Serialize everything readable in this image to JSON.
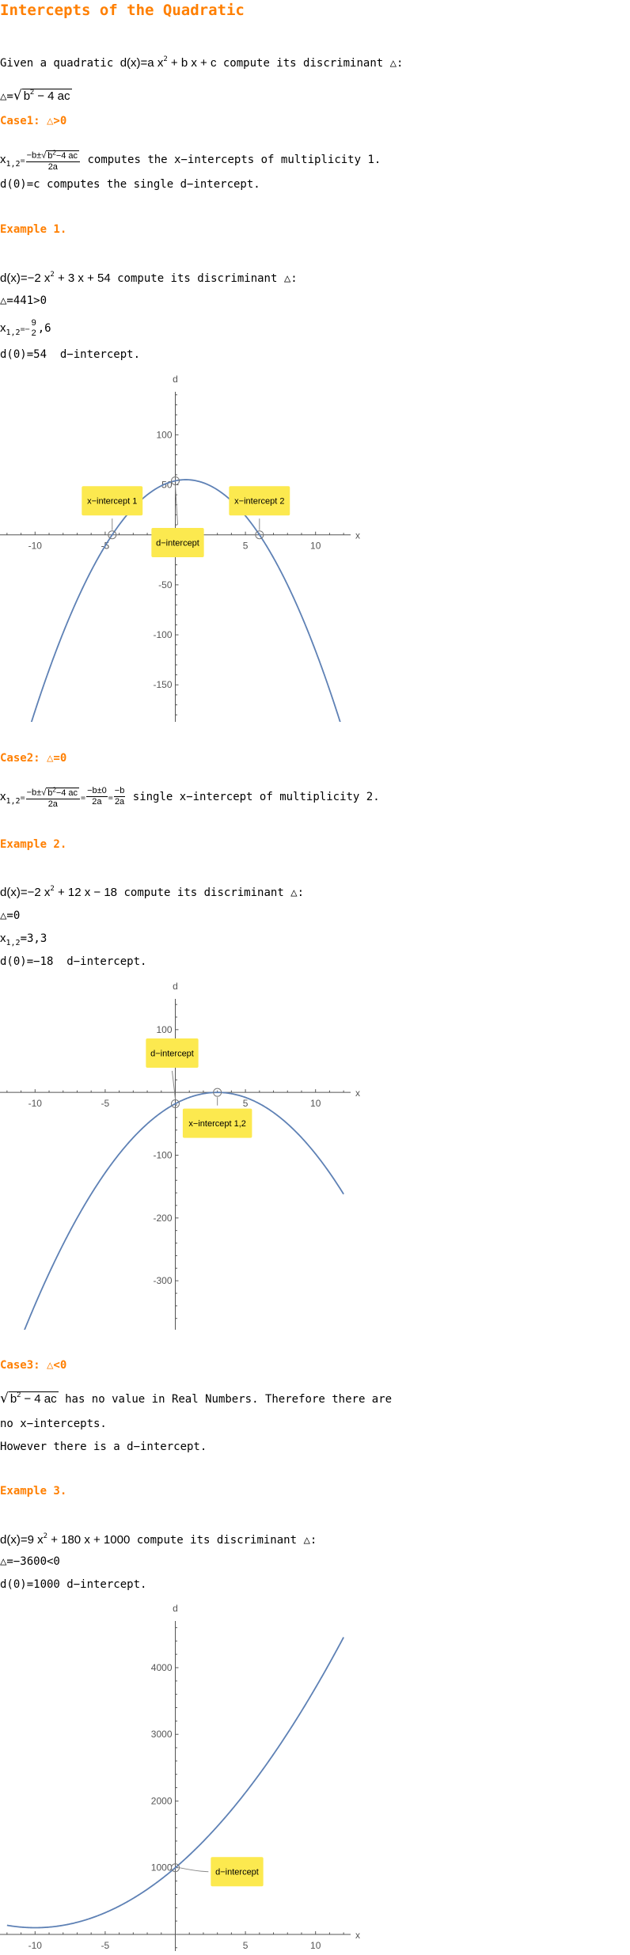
{
  "title": "Intercepts of the Quadratic",
  "intro": {
    "prefix": "Given a quadratic ",
    "lhs": "d(x)=a x",
    "exp": "2",
    "rhs": " + b x + c",
    "suffix": " compute its discriminant △:"
  },
  "discriminant_def": {
    "lhs": "△=",
    "sqrt": "√",
    "base": "b",
    "exp": "2",
    "rest": " − 4 ac"
  },
  "case1": {
    "heading": "Case1: △>0",
    "x_lhs": "x",
    "x_sub": "1,2",
    "eq": "=",
    "num_pre": "−b±",
    "sqrt": "√",
    "rad_base": "b",
    "rad_exp": "2",
    "rad_rest": "−4 ac",
    "den": "2a",
    "text": " computes the x−intercepts of multiplicity 1.",
    "d_line": "d(0)=c computes the single d−intercept."
  },
  "example1": {
    "heading": "Example 1.",
    "fn_lhs": "d(x)=−2 x",
    "fn_exp": "2",
    "fn_rhs": " + 3 x + 54",
    "fn_suffix": " compute its discriminant △:",
    "disc": "△=441>0",
    "roots_lhs": "x",
    "roots_sub": "1,2",
    "roots_eq": "=−",
    "roots_num": "9",
    "roots_den": "2",
    "roots_rest": ",6",
    "d0": "d(0)=54  d−intercept."
  },
  "case2": {
    "heading": "Case2: △=0",
    "x_lhs": "x",
    "x_sub": "1,2",
    "eq": "=",
    "num_pre": "−b±",
    "sqrt": "√",
    "rad_base": "b",
    "rad_exp": "2",
    "rad_rest": "−4 ac",
    "den": "2a",
    "eq2": "=",
    "num2": "−b±0",
    "den2": "2a",
    "eq3": "=",
    "num3": "−b",
    "den3": "2a",
    "text": " single x−intercept of multiplicity 2."
  },
  "example2": {
    "heading": "Example 2.",
    "fn_lhs": "d(x)=−2 x",
    "fn_exp": "2",
    "fn_rhs": " + 12 x − 18",
    "fn_suffix": " compute its discriminant △:",
    "disc": "△=0",
    "roots_lhs": "x",
    "roots_sub": "1,2",
    "roots_rest": "=3,3",
    "d0": "d(0)=−18  d−intercept."
  },
  "case3": {
    "heading": "Case3: △<0",
    "sqrt": "√",
    "base": "b",
    "exp": "2",
    "rest": " − 4 ac",
    "text": " has no value in Real Numbers. Therefore there are",
    "text2": "no x−intercepts.",
    "text3": "However there is a d−intercept."
  },
  "example3": {
    "heading": "Example 3.",
    "fn_lhs": "d(x)=9 x",
    "fn_exp": "2",
    "fn_rhs": " + 180 x + 1000",
    "fn_suffix": " compute its discriminant △:",
    "disc": "△=−3600<0",
    "d0": "d(0)=1000 d−intercept."
  },
  "colors": {
    "heading": "#ff7f00",
    "curve": "#5e81b5",
    "label_bg": "#fce94f",
    "axis": "#555555"
  },
  "chart_data": [
    {
      "type": "line",
      "function": "-2 x^2 + 3 x + 54",
      "coefficients": [
        -2,
        3,
        54
      ],
      "xlabel": "x",
      "ylabel": "d",
      "xlim": [
        -12.5,
        12.5
      ],
      "ylim": [
        -187,
        143
      ],
      "x_ticks": [
        "-10",
        "-5",
        "5",
        "10"
      ],
      "y_ticks": [
        "-150",
        "-100",
        "-50",
        "50",
        "100"
      ],
      "annotations": [
        {
          "label": "x−intercept 1",
          "x": -4.5,
          "y": 0
        },
        {
          "label": "x−intercept 2",
          "x": 6,
          "y": 0
        },
        {
          "label": "d−intercept",
          "x": 0,
          "y": 54
        }
      ]
    },
    {
      "type": "line",
      "function": "-2 x^2 + 12 x - 18",
      "coefficients": [
        -2,
        12,
        -18
      ],
      "xlabel": "x",
      "ylabel": "d",
      "xlim": [
        -12.5,
        12.5
      ],
      "ylim": [
        -378,
        149
      ],
      "x_ticks": [
        "-10",
        "-5",
        "5",
        "10"
      ],
      "y_ticks": [
        "-300",
        "-200",
        "-100",
        "100"
      ],
      "annotations": [
        {
          "label": "d−intercept",
          "x": 0,
          "y": -18
        },
        {
          "label": "x−intercept 1,2",
          "x": 3,
          "y": 0
        }
      ]
    },
    {
      "type": "line",
      "function": "9 x^2 + 180 x + 1000",
      "coefficients": [
        9,
        180,
        1000
      ],
      "xlabel": "x",
      "ylabel": "d",
      "xlim": [
        -12.5,
        12.5
      ],
      "ylim": [
        -250,
        4700
      ],
      "x_ticks": [
        "-10",
        "-5",
        "5",
        "10"
      ],
      "y_ticks": [
        "1000",
        "2000",
        "3000",
        "4000"
      ],
      "annotations": [
        {
          "label": "d−intercept",
          "x": 0,
          "y": 1000
        }
      ]
    }
  ]
}
